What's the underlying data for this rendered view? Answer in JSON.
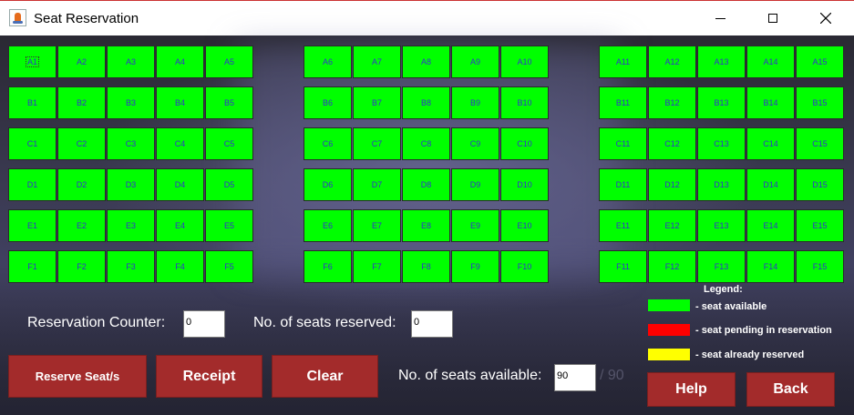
{
  "window": {
    "title": "Seat Reservation"
  },
  "seats": {
    "rows": [
      [
        "A1",
        "A2",
        "A3",
        "A4",
        "A5",
        "A6",
        "A7",
        "A8",
        "A9",
        "A10",
        "A11",
        "A12",
        "A13",
        "A14",
        "A15"
      ],
      [
        "B1",
        "B2",
        "B3",
        "B4",
        "B5",
        "B6",
        "B7",
        "B8",
        "B9",
        "B10",
        "B11",
        "B12",
        "B13",
        "B14",
        "B15"
      ],
      [
        "C1",
        "C2",
        "C3",
        "C4",
        "C5",
        "C6",
        "C7",
        "C8",
        "C9",
        "C10",
        "C11",
        "C12",
        "C13",
        "C14",
        "C15"
      ],
      [
        "D1",
        "D2",
        "D3",
        "D4",
        "D5",
        "D6",
        "D7",
        "D8",
        "D9",
        "D10",
        "D11",
        "D12",
        "D13",
        "D14",
        "D15"
      ],
      [
        "E1",
        "E2",
        "E3",
        "E4",
        "E5",
        "E6",
        "E7",
        "E8",
        "E9",
        "E10",
        "E11",
        "E12",
        "E13",
        "E14",
        "E15"
      ],
      [
        "F1",
        "F2",
        "F3",
        "F4",
        "F5",
        "F6",
        "F7",
        "F8",
        "F9",
        "F10",
        "F11",
        "F12",
        "F13",
        "F14",
        "F15"
      ]
    ],
    "status": "available",
    "focused": "A1"
  },
  "form": {
    "reservation_counter_label": "Reservation Counter:",
    "reservation_counter_value": "0",
    "seats_reserved_label": "No. of seats reserved:",
    "seats_reserved_value": "0",
    "seats_available_label": "No. of seats available:",
    "seats_available_value": "90",
    "seats_total": "/ 90"
  },
  "buttons": {
    "reserve": "Reserve Seat/s",
    "receipt": "Receipt",
    "clear": "Clear",
    "help": "Help",
    "back": "Back"
  },
  "legend": {
    "title": "Legend:",
    "items": [
      {
        "color": "#00ff00",
        "text": "- seat available"
      },
      {
        "color": "#ff0000",
        "text": "- seat pending in reservation"
      },
      {
        "color": "#ffff00",
        "text": "- seat already reserved"
      }
    ]
  },
  "colors": {
    "available": "#00ff00",
    "button": "#a32b2b",
    "seat_text": "#3333cc"
  }
}
